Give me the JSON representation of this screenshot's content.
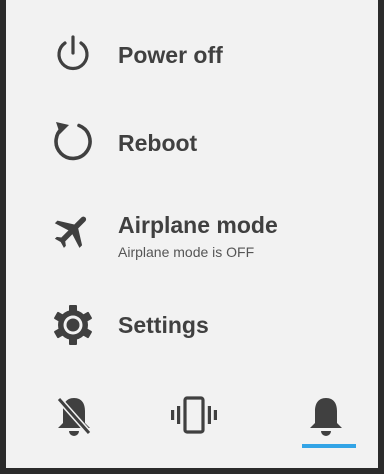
{
  "menu": {
    "items": [
      {
        "id": "power",
        "label": "Power off",
        "icon": "power-icon"
      },
      {
        "id": "reboot",
        "label": "Reboot",
        "icon": "reboot-icon"
      },
      {
        "id": "airplane",
        "label": "Airplane mode",
        "sublabel": "Airplane mode is OFF",
        "icon": "airplane-icon"
      },
      {
        "id": "settings",
        "label": "Settings",
        "icon": "gear-icon"
      }
    ]
  },
  "sound_modes": {
    "options": [
      {
        "id": "mute",
        "icon": "bell-off-icon"
      },
      {
        "id": "vibrate",
        "icon": "vibrate-icon"
      },
      {
        "id": "ring",
        "icon": "bell-icon"
      }
    ],
    "selected": "ring"
  },
  "colors": {
    "accent": "#33a4e6",
    "icon": "#404040",
    "background": "#f2f2f2"
  }
}
